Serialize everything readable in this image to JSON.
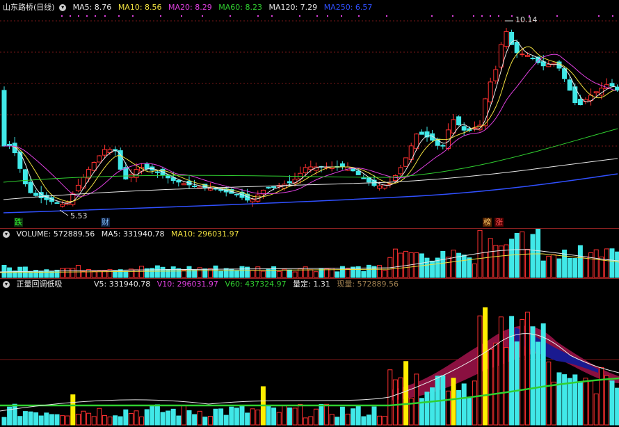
{
  "main": {
    "title": "山东路桥(日线)",
    "ma": [
      {
        "label": "MA5: 8.76",
        "color": "#e8e8e8"
      },
      {
        "label": "MA10: 8.56",
        "color": "#f0e040"
      },
      {
        "label": "MA20: 8.29",
        "color": "#e040e0"
      },
      {
        "label": "MA60: 8.23",
        "color": "#30d030"
      },
      {
        "label": "MA120: 7.29",
        "color": "#e8e8e8"
      },
      {
        "label": "MA250: 6.57",
        "color": "#3050ff"
      }
    ],
    "high_label": "10.14",
    "low_label": "5.53",
    "markers": [
      {
        "text": "跌",
        "color": "#30ff30",
        "bg": "#103010"
      },
      {
        "text": "财",
        "color": "#80c0ff",
        "bg": "#102040"
      },
      {
        "text": "榜",
        "color": "#ffcc66",
        "bg": "#502000"
      },
      {
        "text": "涨",
        "color": "#ff5050",
        "bg": "#500000"
      }
    ]
  },
  "volume": {
    "title": "VOLUME: 572889.56",
    "ma5": "MA5: 331940.78",
    "ma10": "MA10: 296031.97"
  },
  "indicator": {
    "title": "正量回调低吸",
    "v5": "V5: 331940.78",
    "v10": "V10: 296031.97",
    "v60": "V60: 437324.97",
    "ratio": "量定: 1.31",
    "now": "现量: 572889.56"
  },
  "colors": {
    "up": "#ff3030",
    "down": "#40e8e8",
    "bg": "#000000",
    "grid": "#7a1818"
  }
}
